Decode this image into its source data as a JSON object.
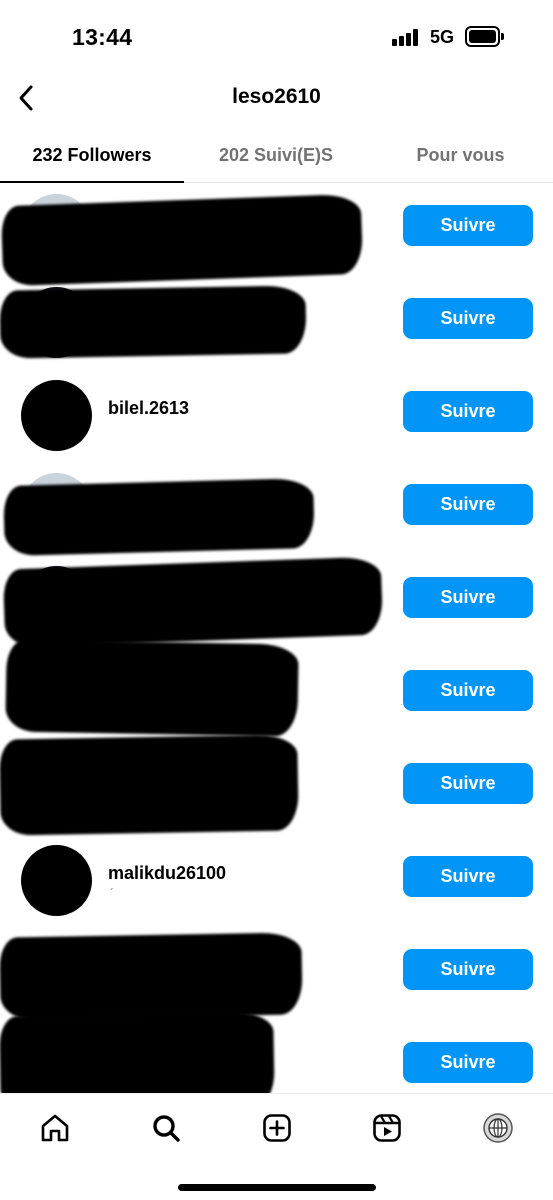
{
  "status_bar": {
    "time": "13:44",
    "network": "5G",
    "icons": [
      "signal-icon",
      "battery-icon"
    ]
  },
  "header": {
    "title": "leso2610",
    "back_icon": "chevron-left-icon"
  },
  "tabs": [
    {
      "label": "232 Followers",
      "active": true
    },
    {
      "label": "202 Suivi(E)S",
      "active": false
    },
    {
      "label": "Pour vous",
      "active": false
    }
  ],
  "followers": [
    {
      "username": "",
      "subtext": "",
      "redacted": true,
      "button": "Suivre"
    },
    {
      "username": "",
      "subtext": "",
      "redacted": true,
      "button": "Suivre"
    },
    {
      "username": "bilel.2613",
      "subtext": "",
      "redacted": false,
      "button": "Suivre"
    },
    {
      "username": "",
      "subtext": "",
      "redacted": true,
      "button": "Suivre"
    },
    {
      "username": "",
      "subtext": "",
      "redacted": true,
      "button": "Suivre"
    },
    {
      "username": "",
      "subtext": "",
      "redacted": true,
      "button": "Suivre"
    },
    {
      "username": "",
      "subtext": "",
      "redacted": true,
      "button": "Suivre"
    },
    {
      "username": "malikdu26100",
      "subtext": "´",
      "redacted": false,
      "button": "Suivre"
    },
    {
      "username": "",
      "subtext": "",
      "redacted": true,
      "button": "Suivre"
    },
    {
      "username": "",
      "subtext": "",
      "redacted": true,
      "button": "Suivre"
    }
  ],
  "bottom_nav": [
    {
      "icon": "home-icon"
    },
    {
      "icon": "search-icon"
    },
    {
      "icon": "create-post-icon"
    },
    {
      "icon": "reels-icon"
    },
    {
      "icon": "profile-avatar-icon"
    }
  ],
  "colors": {
    "accent": "#0095f6",
    "text": "#000000",
    "muted": "#737373"
  }
}
